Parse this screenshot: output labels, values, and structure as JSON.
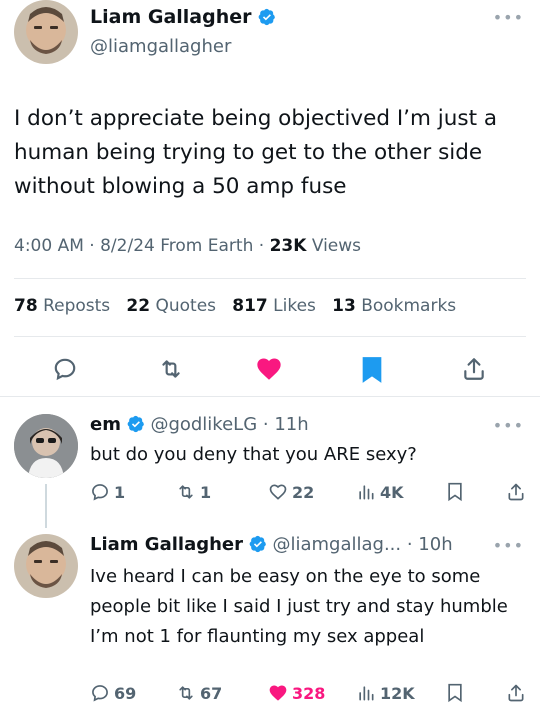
{
  "main_tweet": {
    "author_name": "Liam Gallagher",
    "handle": "@liamgallagher",
    "text": "I don’t appreciate being objectived I’m just a human being trying to get to the other side without blowing a 50 amp fuse",
    "time": "4:00 AM",
    "date": "8/2/24",
    "source": "From Earth",
    "views_count": "23K",
    "views_label": "Views",
    "reposts_count": "78",
    "reposts_label": "Reposts",
    "quotes_count": "22",
    "quotes_label": "Quotes",
    "likes_count": "817",
    "likes_label": "Likes",
    "bookmarks_count": "13",
    "bookmarks_label": "Bookmarks"
  },
  "replies": [
    {
      "author_name": "em",
      "handle": "@godlikeLG",
      "age": "11h",
      "text": "but do you deny that you ARE sexy?",
      "reply_count": "1",
      "repost_count": "1",
      "like_count": "22",
      "view_count": "4K"
    },
    {
      "author_name": "Liam Gallagher",
      "handle": "@liamgallag...",
      "age": "10h",
      "text": "Ive heard I can be easy on the eye to some people bit like I said I just try and stay humble I’m not 1 for flaunting my sex appeal",
      "reply_count": "69",
      "repost_count": "67",
      "like_count": "328",
      "view_count": "12K"
    }
  ],
  "colors": {
    "accent": "#1d9bf0",
    "like": "#f91880",
    "text": "#0f1419",
    "secondary": "#536471"
  },
  "icons": [
    "more-icon",
    "verified-icon",
    "reply-icon",
    "repost-icon",
    "like-icon",
    "bookmark-icon",
    "share-icon",
    "views-icon"
  ]
}
